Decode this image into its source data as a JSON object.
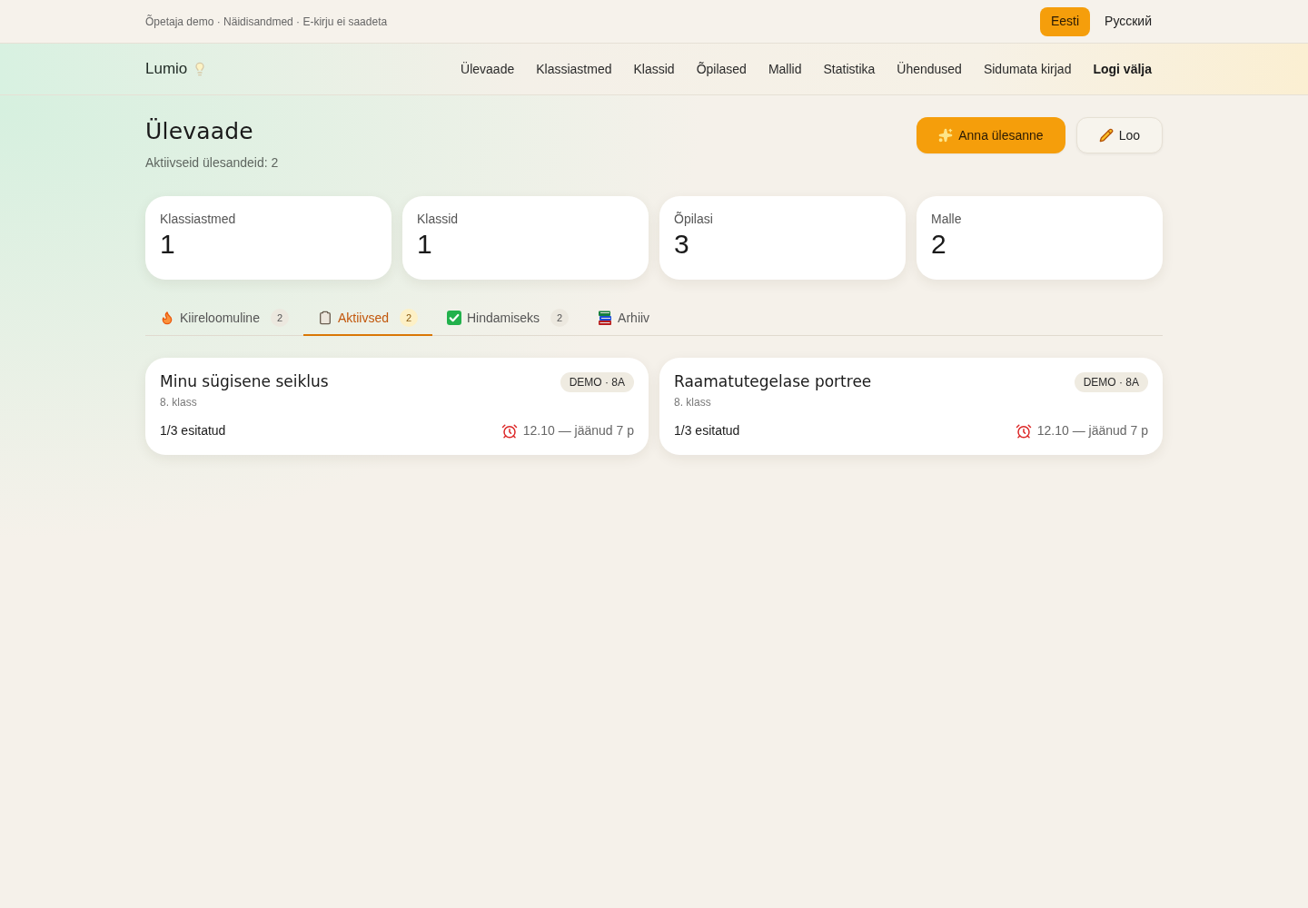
{
  "top_bar": {
    "notice": "Õpetaja demo · Näidisandmed · E-kirju ei saadeta",
    "languages": [
      {
        "label": "Eesti",
        "selected": true
      },
      {
        "label": "Русский",
        "selected": false
      }
    ]
  },
  "nav": {
    "brand": "Lumio",
    "items": [
      {
        "label": "Ülevaade",
        "kind": "link"
      },
      {
        "label": "Klassiastmed",
        "kind": "link"
      },
      {
        "label": "Klassid",
        "kind": "link"
      },
      {
        "label": "Õpilased",
        "kind": "link"
      },
      {
        "label": "Mallid",
        "kind": "link"
      },
      {
        "label": "Statistika",
        "kind": "link"
      },
      {
        "label": "Ühendused",
        "kind": "link"
      },
      {
        "label": "Sidumata kirjad",
        "kind": "link"
      },
      {
        "label": "Logi välja",
        "kind": "logout"
      }
    ]
  },
  "page": {
    "title": "Ülevaade",
    "subtitle": "Aktiivseid ülesandeid: 2",
    "actions": [
      {
        "label": "Anna ülesanne",
        "kind": "primary"
      },
      {
        "label": "Loo",
        "kind": "secondary"
      }
    ]
  },
  "stats": [
    {
      "label": "Klassiastmed",
      "value": "1"
    },
    {
      "label": "Klassid",
      "value": "1"
    },
    {
      "label": "Õpilasi",
      "value": "3"
    },
    {
      "label": "Malle",
      "value": "2"
    }
  ],
  "tabs": [
    {
      "label": "Kiireloomuline",
      "count": "2",
      "selected": false,
      "kind": "urgent"
    },
    {
      "label": "Aktiivsed",
      "count": "2",
      "selected": true,
      "kind": "active"
    },
    {
      "label": "Hindamiseks",
      "count": "2",
      "selected": false,
      "kind": "grading"
    },
    {
      "label": "Arhiiv",
      "selected": false,
      "kind": "archive"
    }
  ],
  "assignments": [
    {
      "title": "Minu sügisene seiklus",
      "grade": "8. klass",
      "badge": "DEMO · 8A",
      "submitted": "1/3 esitatud",
      "due": "12.10 — jäänud 7 p"
    },
    {
      "title": "Raamatutegelase portree",
      "grade": "8. klass",
      "badge": "DEMO · 8A",
      "submitted": "1/3 esitatud",
      "due": "12.10 — jäänud 7 p"
    }
  ]
}
